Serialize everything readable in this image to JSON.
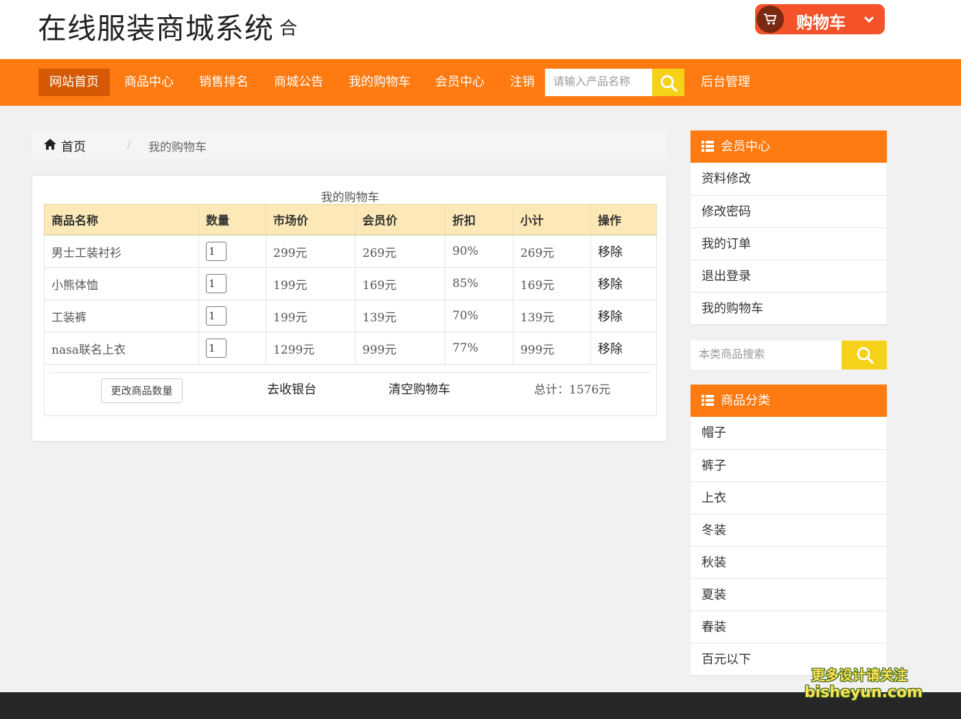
{
  "header": {
    "site_title": "在线服装商城系统",
    "site_title_suffix": "合",
    "cart_button_label": "购物车"
  },
  "nav": {
    "items": [
      "网站首页",
      "商品中心",
      "销售排名",
      "商城公告",
      "我的购物车",
      "会员中心",
      "注销"
    ],
    "active_index": 0,
    "search_placeholder": "请输入产品名称",
    "admin_label": "后台管理"
  },
  "breadcrumb": {
    "home": "首页",
    "separator": "/",
    "current": "我的购物车"
  },
  "cart": {
    "caption": "我的购物车",
    "columns": [
      "商品名称",
      "数量",
      "市场价",
      "会员价",
      "折扣",
      "小计",
      "操作"
    ],
    "rows": [
      {
        "name": "男士工装衬衫",
        "qty": "1",
        "market": "299元",
        "member": "269元",
        "discount": "90%",
        "subtotal": "269元",
        "action": "移除"
      },
      {
        "name": "小熊体恤",
        "qty": "1",
        "market": "199元",
        "member": "169元",
        "discount": "85%",
        "subtotal": "169元",
        "action": "移除"
      },
      {
        "name": "工装裤",
        "qty": "1",
        "market": "199元",
        "member": "139元",
        "discount": "70%",
        "subtotal": "139元",
        "action": "移除"
      },
      {
        "name": "nasa联名上衣",
        "qty": "1",
        "market": "1299元",
        "member": "999元",
        "discount": "77%",
        "subtotal": "999元",
        "action": "移除"
      }
    ],
    "update_button": "更改商品数量",
    "checkout_label": "去收银台",
    "clear_label": "清空购物车",
    "total_label": "总计：1576元"
  },
  "sidebar": {
    "member_title": "会员中心",
    "member_items": [
      "资料修改",
      "修改密码",
      "我的订单",
      "退出登录",
      "我的购物车"
    ],
    "search_placeholder": "本类商品搜索",
    "category_title": "商品分类",
    "category_items": [
      "帽子",
      "裤子",
      "上衣",
      "冬装",
      "秋装",
      "夏装",
      "春装",
      "百元以下"
    ]
  },
  "watermark": {
    "line1": "更多设计请关注",
    "line2": "bisheyun.com"
  },
  "colors": {
    "nav_bg": "#ff7a10",
    "nav_active": "#d65a05",
    "search_btn": "#f5d11a",
    "cart_btn": "#f4532a",
    "table_head": "#fde9b7",
    "footer_bg": "#262626"
  }
}
